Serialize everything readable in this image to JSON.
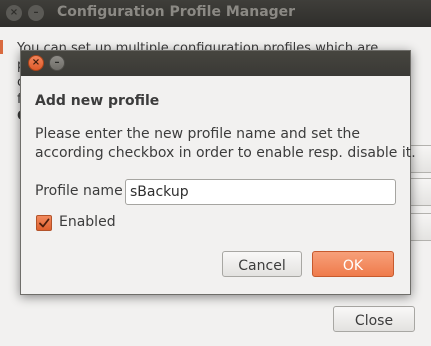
{
  "parent_window": {
    "title": "Configuration Profile Manager",
    "close_glyph": "×",
    "minimize_glyph": "–",
    "description_lines": [
      "You can set up multiple configuration profiles which are",
      "p",
      "c",
      "f"
    ],
    "section_initial": "C",
    "close_label": "Close"
  },
  "dialog": {
    "close_glyph": "×",
    "minimize_glyph": "–",
    "heading": "Add new profile",
    "message_lines": [
      "Please enter the new profile name and set the",
      "according checkbox in order to enable resp. disable it."
    ],
    "profile_name_label": "Profile name",
    "profile_name_value": "sBackup",
    "enabled_label": "Enabled",
    "enabled_checked": true,
    "cancel_label": "Cancel",
    "ok_label": "OK"
  },
  "colors": {
    "accent": "#ef7b4b",
    "titlebar": "#3a3935",
    "window_bg": "#f2f1f0"
  },
  "icons": {
    "close": "close-icon",
    "minimize": "minimize-icon",
    "check": "check-icon"
  }
}
